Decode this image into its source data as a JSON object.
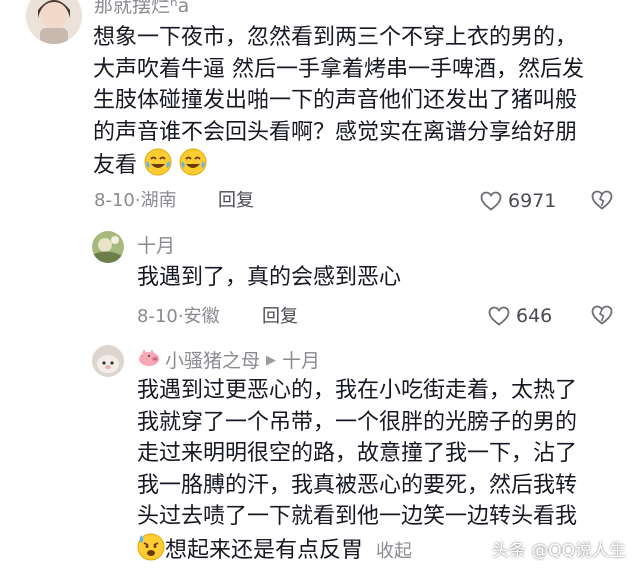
{
  "comments": [
    {
      "username": "那就摆烂ⁿa",
      "lines": [
        "想象一下夜市，忽然看到两三个不穿上衣的男的，",
        "大声吹着牛逼 然后一手拿着烤串一手啤酒，然后发",
        "生肢体碰撞发出啪一下的声音他们还发出了猪叫般",
        "的声音谁不会回头看啊？感觉实在离谱分享给好朋",
        "友看"
      ],
      "date": "8-10",
      "location": "湖南",
      "reply_label": "回复",
      "likes": "6971",
      "emoji": "laughing-tears-emoji"
    },
    {
      "username": "十月",
      "lines": [
        "我遇到了，真的会感到恶心"
      ],
      "date": "8-10",
      "location": "安徽",
      "reply_label": "回复",
      "likes": "646"
    },
    {
      "username": "小骚猪之母",
      "badge_icon": "pig-emoji",
      "reply_to": "十月",
      "lines": [
        "我遇到过更恶心的，我在小吃街走着，太热了",
        "我就穿了一个吊带，一个很胖的光膀子的男的",
        "走过来明明很空的路，故意撞了我一下，沾了",
        "我一胳膊的汗，我真被恶心的要死，然后我转",
        "头过去啧了一下就看到他一边笑一边转头看我",
        "想起来还是有点反胃"
      ],
      "collapse_label": "收起",
      "emoji": "anxious-sweat-emoji"
    }
  ],
  "separator": "·",
  "watermark": "头条 @QQ说人生"
}
